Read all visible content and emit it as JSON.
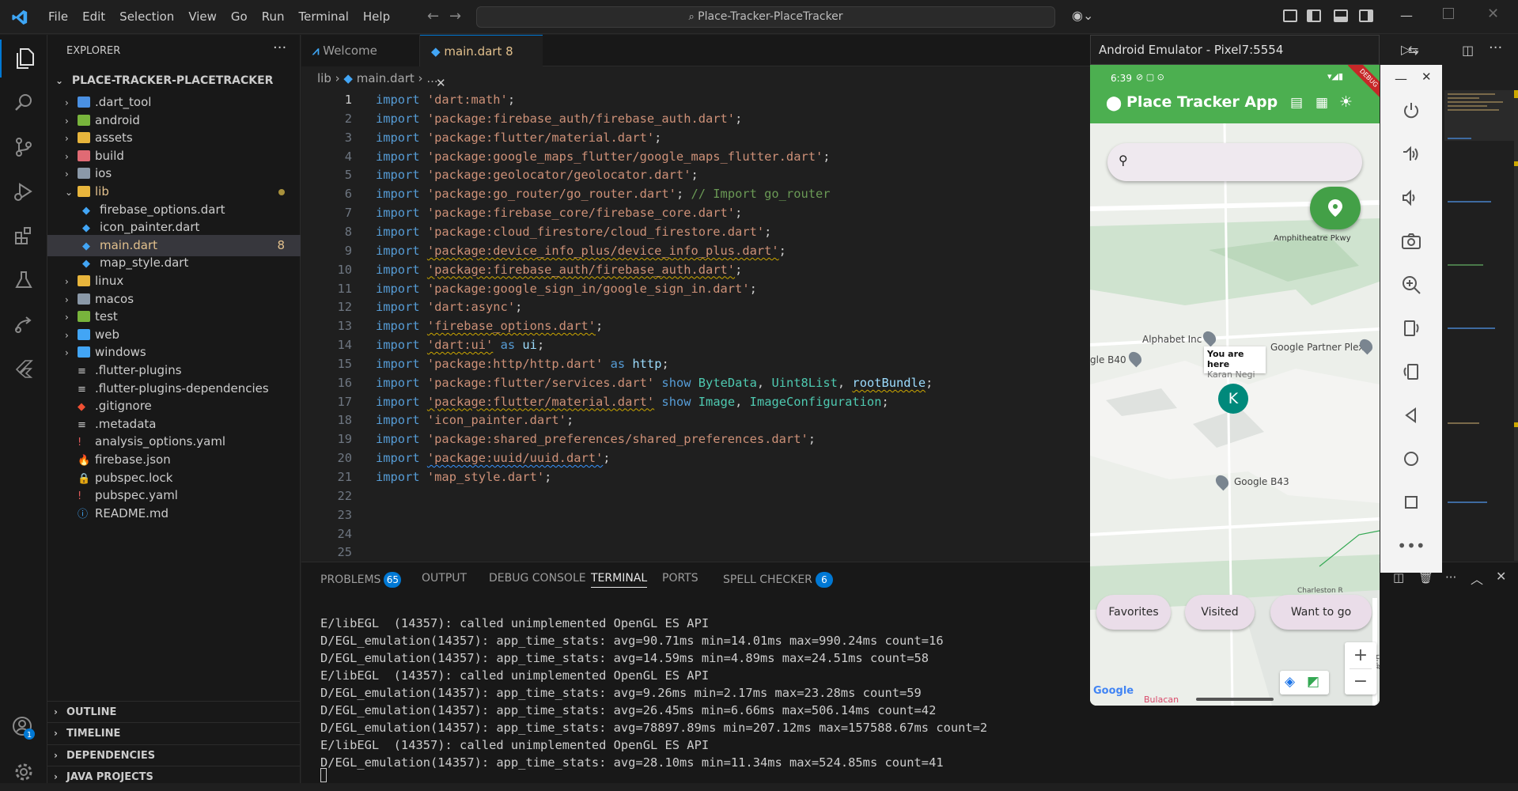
{
  "window": {
    "menu": [
      "File",
      "Edit",
      "Selection",
      "View",
      "Go",
      "Run",
      "Terminal",
      "Help"
    ],
    "search": "Place-Tracker-PlaceTracker"
  },
  "explorer": {
    "title": "EXPLORER",
    "root": "PLACE-TRACKER-PLACETRACKER",
    "items": [
      {
        "label": ".dart_tool",
        "kind": "folder",
        "color": "#4a90e2",
        "indent": 1,
        "chev": "›"
      },
      {
        "label": "android",
        "kind": "folder",
        "color": "#78b43c",
        "indent": 1,
        "chev": "›"
      },
      {
        "label": "assets",
        "kind": "folder",
        "color": "#e8b53c",
        "indent": 1,
        "chev": "›"
      },
      {
        "label": "build",
        "kind": "folder",
        "color": "#e06a74",
        "indent": 1,
        "chev": "›"
      },
      {
        "label": "ios",
        "kind": "folder",
        "color": "#8b99a8",
        "indent": 1,
        "chev": "›"
      },
      {
        "label": "lib",
        "kind": "folder",
        "color": "#e8b53c",
        "indent": 1,
        "chev": "⌄",
        "status": "dot"
      },
      {
        "label": "firebase_options.dart",
        "kind": "dart",
        "color": "#42a5f5",
        "indent": 2
      },
      {
        "label": "icon_painter.dart",
        "kind": "dart",
        "color": "#42a5f5",
        "indent": 2
      },
      {
        "label": "main.dart",
        "kind": "dart",
        "color": "#42a5f5",
        "indent": 2,
        "status": "8",
        "selected": true
      },
      {
        "label": "map_style.dart",
        "kind": "dart",
        "color": "#42a5f5",
        "indent": 2
      },
      {
        "label": "linux",
        "kind": "folder",
        "color": "#e8b53c",
        "indent": 1,
        "chev": "›"
      },
      {
        "label": "macos",
        "kind": "folder",
        "color": "#8b99a8",
        "indent": 1,
        "chev": "›"
      },
      {
        "label": "test",
        "kind": "folder",
        "color": "#78b43c",
        "indent": 1,
        "chev": "›"
      },
      {
        "label": "web",
        "kind": "folder",
        "color": "#42a5f5",
        "indent": 1,
        "chev": "›"
      },
      {
        "label": "windows",
        "kind": "folder",
        "color": "#42a5f5",
        "indent": 1,
        "chev": "›"
      },
      {
        "label": ".flutter-plugins",
        "kind": "file",
        "color": "#cccccc",
        "indent": 1
      },
      {
        "label": ".flutter-plugins-dependencies",
        "kind": "file",
        "color": "#cccccc",
        "indent": 1
      },
      {
        "label": ".gitignore",
        "kind": "git",
        "color": "#f05033",
        "indent": 1
      },
      {
        "label": ".metadata",
        "kind": "file",
        "color": "#cccccc",
        "indent": 1
      },
      {
        "label": "analysis_options.yaml",
        "kind": "yaml",
        "color": "#e05a5a",
        "indent": 1
      },
      {
        "label": "firebase.json",
        "kind": "fire",
        "color": "#ffa000",
        "indent": 1
      },
      {
        "label": "pubspec.lock",
        "kind": "lock",
        "color": "#e8b53c",
        "indent": 1
      },
      {
        "label": "pubspec.yaml",
        "kind": "yaml",
        "color": "#e05a5a",
        "indent": 1
      },
      {
        "label": "README.md",
        "kind": "info",
        "color": "#42a5f5",
        "indent": 1
      }
    ],
    "sections": [
      "OUTLINE",
      "TIMELINE",
      "DEPENDENCIES",
      "JAVA PROJECTS"
    ]
  },
  "tabs": [
    {
      "label": "Welcome",
      "active": false
    },
    {
      "label": "main.dart",
      "badge": "8",
      "active": true
    }
  ],
  "breadcrumb": {
    "folder": "lib",
    "file": "main.dart",
    "rest": "..."
  },
  "code": [
    [
      [
        "kw",
        "import"
      ],
      [
        "t",
        " "
      ],
      [
        "str",
        "'dart:math'"
      ],
      [
        "t",
        ";"
      ]
    ],
    [
      [
        "kw",
        "import"
      ],
      [
        "t",
        " "
      ],
      [
        "str",
        "'package:firebase_auth/firebase_auth.dart'"
      ],
      [
        "t",
        ";"
      ]
    ],
    [
      [
        "kw",
        "import"
      ],
      [
        "t",
        " "
      ],
      [
        "str",
        "'package:flutter/material.dart'"
      ],
      [
        "t",
        ";"
      ]
    ],
    [
      [
        "kw",
        "import"
      ],
      [
        "t",
        " "
      ],
      [
        "str",
        "'package:google_maps_flutter/google_maps_flutter.dart'"
      ],
      [
        "t",
        ";"
      ]
    ],
    [
      [
        "kw",
        "import"
      ],
      [
        "t",
        " "
      ],
      [
        "str",
        "'package:geolocator/geolocator.dart'"
      ],
      [
        "t",
        ";"
      ]
    ],
    [
      [
        "kw",
        "import"
      ],
      [
        "t",
        " "
      ],
      [
        "str",
        "'package:go_router/go_router.dart'"
      ],
      [
        "t",
        "; "
      ],
      [
        "cmt",
        "// Import go_router"
      ]
    ],
    [
      [
        "kw",
        "import"
      ],
      [
        "t",
        " "
      ],
      [
        "str",
        "'package:firebase_core/firebase_core.dart'"
      ],
      [
        "t",
        ";"
      ]
    ],
    [
      [
        "kw",
        "import"
      ],
      [
        "t",
        " "
      ],
      [
        "str",
        "'package:cloud_firestore/cloud_firestore.dart'"
      ],
      [
        "t",
        ";"
      ]
    ],
    [
      [
        "kw",
        "import"
      ],
      [
        "t",
        " "
      ],
      [
        "strsq",
        "'package:device_info_plus/device_info_plus.dart'"
      ],
      [
        "t",
        ";"
      ]
    ],
    [
      [
        "kw",
        "import"
      ],
      [
        "t",
        " "
      ],
      [
        "strsq",
        "'package:firebase_auth/firebase_auth.dart'"
      ],
      [
        "t",
        ";"
      ]
    ],
    [
      [
        "kw",
        "import"
      ],
      [
        "t",
        " "
      ],
      [
        "str",
        "'package:google_sign_in/google_sign_in.dart'"
      ],
      [
        "t",
        ";"
      ]
    ],
    [
      [
        "kw",
        "import"
      ],
      [
        "t",
        " "
      ],
      [
        "str",
        "'dart:async'"
      ],
      [
        "t",
        ";"
      ]
    ],
    [
      [
        "kw",
        "import"
      ],
      [
        "t",
        " "
      ],
      [
        "strsq",
        "'firebase_options.dart'"
      ],
      [
        "t",
        ";"
      ]
    ],
    [
      [
        "kw",
        "import"
      ],
      [
        "t",
        " "
      ],
      [
        "strsq",
        "'dart:ui'"
      ],
      [
        "t",
        " "
      ],
      [
        "kw",
        "as"
      ],
      [
        "t",
        " "
      ],
      [
        "var",
        "ui"
      ],
      [
        "t",
        ";"
      ]
    ],
    [
      [
        "kw",
        "import"
      ],
      [
        "t",
        " "
      ],
      [
        "str",
        "'package:http/http.dart'"
      ],
      [
        "t",
        " "
      ],
      [
        "kw",
        "as"
      ],
      [
        "t",
        " "
      ],
      [
        "var",
        "http"
      ],
      [
        "t",
        ";"
      ]
    ],
    [
      [
        "kw",
        "import"
      ],
      [
        "t",
        " "
      ],
      [
        "str",
        "'package:flutter/services.dart'"
      ],
      [
        "t",
        " "
      ],
      [
        "kw",
        "show"
      ],
      [
        "t",
        " "
      ],
      [
        "ty",
        "ByteData"
      ],
      [
        "t",
        ", "
      ],
      [
        "ty",
        "Uint8List"
      ],
      [
        "t",
        ", "
      ],
      [
        "varsq",
        "rootBundle"
      ],
      [
        "t",
        ";"
      ]
    ],
    [
      [
        "kw",
        "import"
      ],
      [
        "t",
        " "
      ],
      [
        "strsq",
        "'package:flutter/material.dart'"
      ],
      [
        "t",
        " "
      ],
      [
        "kw",
        "show"
      ],
      [
        "t",
        " "
      ],
      [
        "ty",
        "Image"
      ],
      [
        "t",
        ", "
      ],
      [
        "ty",
        "ImageConfiguration"
      ],
      [
        "t",
        ";"
      ]
    ],
    [
      [
        "kw",
        "import"
      ],
      [
        "t",
        " "
      ],
      [
        "str",
        "'icon_painter.dart'"
      ],
      [
        "t",
        ";"
      ]
    ],
    [
      [
        "kw",
        "import"
      ],
      [
        "t",
        " "
      ],
      [
        "str",
        "'package:shared_preferences/shared_preferences.dart'"
      ],
      [
        "t",
        ";"
      ]
    ],
    [
      [
        "kw",
        "import"
      ],
      [
        "t",
        " "
      ],
      [
        "strsqb",
        "'package:uuid/uuid.dart'"
      ],
      [
        "t",
        ";"
      ]
    ],
    [
      [
        "kw",
        "import"
      ],
      [
        "t",
        " "
      ],
      [
        "str",
        "'map_style.dart'"
      ],
      [
        "t",
        ";"
      ]
    ],
    [],
    [],
    [],
    []
  ],
  "panel": {
    "tabs": [
      {
        "label": "PROBLEMS",
        "badge": "65"
      },
      {
        "label": "OUTPUT"
      },
      {
        "label": "DEBUG CONSOLE"
      },
      {
        "label": "TERMINAL",
        "active": true
      },
      {
        "label": "PORTS"
      },
      {
        "label": "SPELL CHECKER",
        "badge": "6"
      }
    ],
    "terminal": [
      "E/libEGL  (14357): called unimplemented OpenGL ES API",
      "D/EGL_emulation(14357): app_time_stats: avg=90.71ms min=14.01ms max=990.24ms count=16",
      "D/EGL_emulation(14357): app_time_stats: avg=14.59ms min=4.89ms max=24.51ms count=58",
      "E/libEGL  (14357): called unimplemented OpenGL ES API",
      "D/EGL_emulation(14357): app_time_stats: avg=9.26ms min=2.17ms max=23.28ms count=59",
      "D/EGL_emulation(14357): app_time_stats: avg=26.45ms min=6.66ms max=506.14ms count=42",
      "D/EGL_emulation(14357): app_time_stats: avg=78897.89ms min=207.12ms max=157588.67ms count=2",
      "E/libEGL  (14357): called unimplemented OpenGL ES API",
      "D/EGL_emulation(14357): app_time_stats: avg=28.10ms min=11.34ms max=524.85ms count=41"
    ]
  },
  "emulator": {
    "title": "Android Emulator - Pixel7:5554",
    "time": "6:39",
    "debug": "DEBUG",
    "app_title": "Place Tracker App",
    "search_placeholder": "",
    "street": "Amphitheatre Pkwy",
    "places": {
      "alphabet": "Alphabet Inc",
      "partner": "Google Partner Plex",
      "b40": "gle B40",
      "b43": "Google B43"
    },
    "you_are_here": "You are here",
    "user_name": "Karan Negi",
    "avatar_letter": "K",
    "chips": [
      "Favorites",
      "Visited",
      "Want to go"
    ],
    "street2": "Charleston R",
    "street3": "Huff Ave",
    "brand": "Google",
    "place4": "Bulacan",
    "zoom_in": "+",
    "zoom_out": "−"
  },
  "colors": {
    "accent_green": "#4caf50",
    "fab_green": "#43a047",
    "avatar_teal": "#00897b",
    "chip_bg": "#eadde9"
  }
}
